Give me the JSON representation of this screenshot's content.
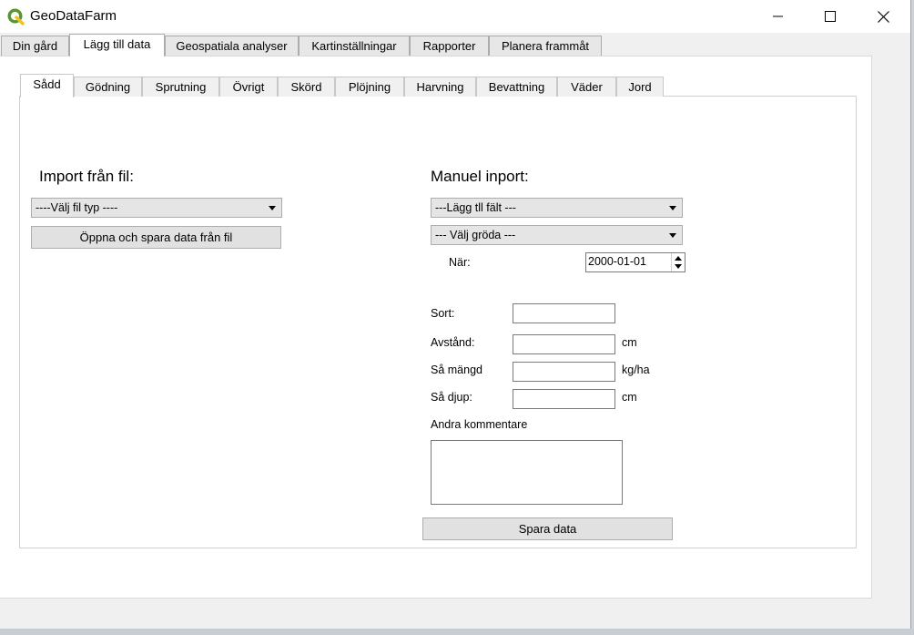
{
  "window": {
    "title": "GeoDataFarm",
    "icon": "qgis-logo-icon",
    "controls": [
      "minimize-icon",
      "maximize-icon",
      "close-icon"
    ]
  },
  "outer_tabs": [
    {
      "label": "Din gård",
      "active": false
    },
    {
      "label": "Lägg till data",
      "active": true
    },
    {
      "label": "Geospatiala analyser",
      "active": false
    },
    {
      "label": "Kartinställningar",
      "active": false
    },
    {
      "label": "Rapporter",
      "active": false
    },
    {
      "label": "Planera frammåt",
      "active": false
    }
  ],
  "inner_tabs": [
    {
      "label": "Sådd",
      "active": true
    },
    {
      "label": "Gödning",
      "active": false
    },
    {
      "label": "Sprutning",
      "active": false
    },
    {
      "label": "Övrigt",
      "active": false
    },
    {
      "label": "Skörd",
      "active": false
    },
    {
      "label": "Plöjning",
      "active": false
    },
    {
      "label": "Harvning",
      "active": false
    },
    {
      "label": "Bevattning",
      "active": false
    },
    {
      "label": "Väder",
      "active": false
    },
    {
      "label": "Jord",
      "active": false
    }
  ],
  "import_section": {
    "title": "Import från fil:",
    "file_type_select": "----Välj fil typ ----",
    "open_save_button": "Öppna och spara data från fil"
  },
  "manual_section": {
    "title": "Manuel inport:",
    "field_select": "---Lägg tll fält ---",
    "crop_select": "--- Välj gröda ---",
    "when_label": "När:",
    "date_value": "2000-01-01",
    "sort_label": "Sort:",
    "sort_value": "",
    "distance_label": "Avstånd:",
    "distance_value": "",
    "distance_unit": "cm",
    "amount_label": "Så mängd",
    "amount_value": "",
    "amount_unit": "kg/ha",
    "depth_label": "Så djup:",
    "depth_value": "",
    "depth_unit": "cm",
    "comments_label": "Andra kommentare",
    "comments_value": "",
    "save_button": "Spara data"
  }
}
